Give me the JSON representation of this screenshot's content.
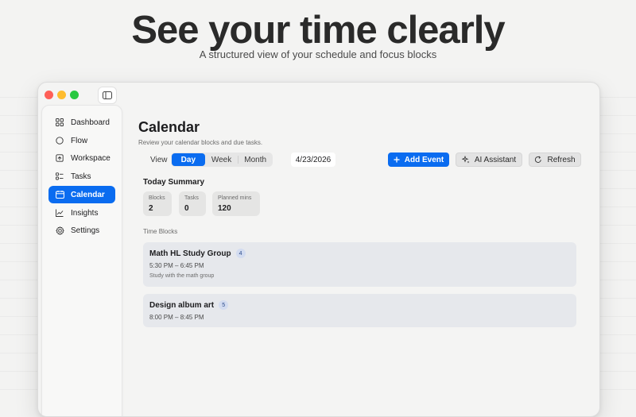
{
  "hero": {
    "title": "See your time clearly",
    "subtitle": "A structured view of your schedule and focus blocks"
  },
  "sidebar": {
    "items": [
      {
        "label": "Dashboard",
        "icon": "grid-icon",
        "active": false
      },
      {
        "label": "Flow",
        "icon": "circle-icon",
        "active": false
      },
      {
        "label": "Workspace",
        "icon": "workspace-icon",
        "active": false
      },
      {
        "label": "Tasks",
        "icon": "checklist-icon",
        "active": false
      },
      {
        "label": "Calendar",
        "icon": "calendar-icon",
        "active": true
      },
      {
        "label": "Insights",
        "icon": "chart-line-icon",
        "active": false
      },
      {
        "label": "Settings",
        "icon": "gear-icon",
        "active": false
      }
    ]
  },
  "main": {
    "title": "Calendar",
    "subtitle": "Review your calendar blocks and due tasks.",
    "view_label": "View",
    "view_options": [
      "Day",
      "Week",
      "Month"
    ],
    "selected_view": "Day",
    "date": "4/23/2026",
    "buttons": {
      "add_event": "Add Event",
      "ai_assistant": "AI Assistant",
      "refresh": "Refresh"
    },
    "summary": {
      "title": "Today Summary",
      "stats": [
        {
          "label": "Blocks",
          "value": "2"
        },
        {
          "label": "Tasks",
          "value": "0"
        },
        {
          "label": "Planned mins",
          "value": "120"
        }
      ]
    },
    "time_blocks_label": "Time Blocks",
    "time_blocks": [
      {
        "title": "Math HL Study Group",
        "badge": "4",
        "time": "5:30 PM – 6:45 PM",
        "description": "Study with the math group"
      },
      {
        "title": "Design album art",
        "badge": "5",
        "time": "8:00 PM – 8:45 PM",
        "description": ""
      }
    ]
  },
  "colors": {
    "accent": "#0a6cf0",
    "traffic_red": "#fe5f57",
    "traffic_yellow": "#febc2e",
    "traffic_green": "#28c840"
  }
}
